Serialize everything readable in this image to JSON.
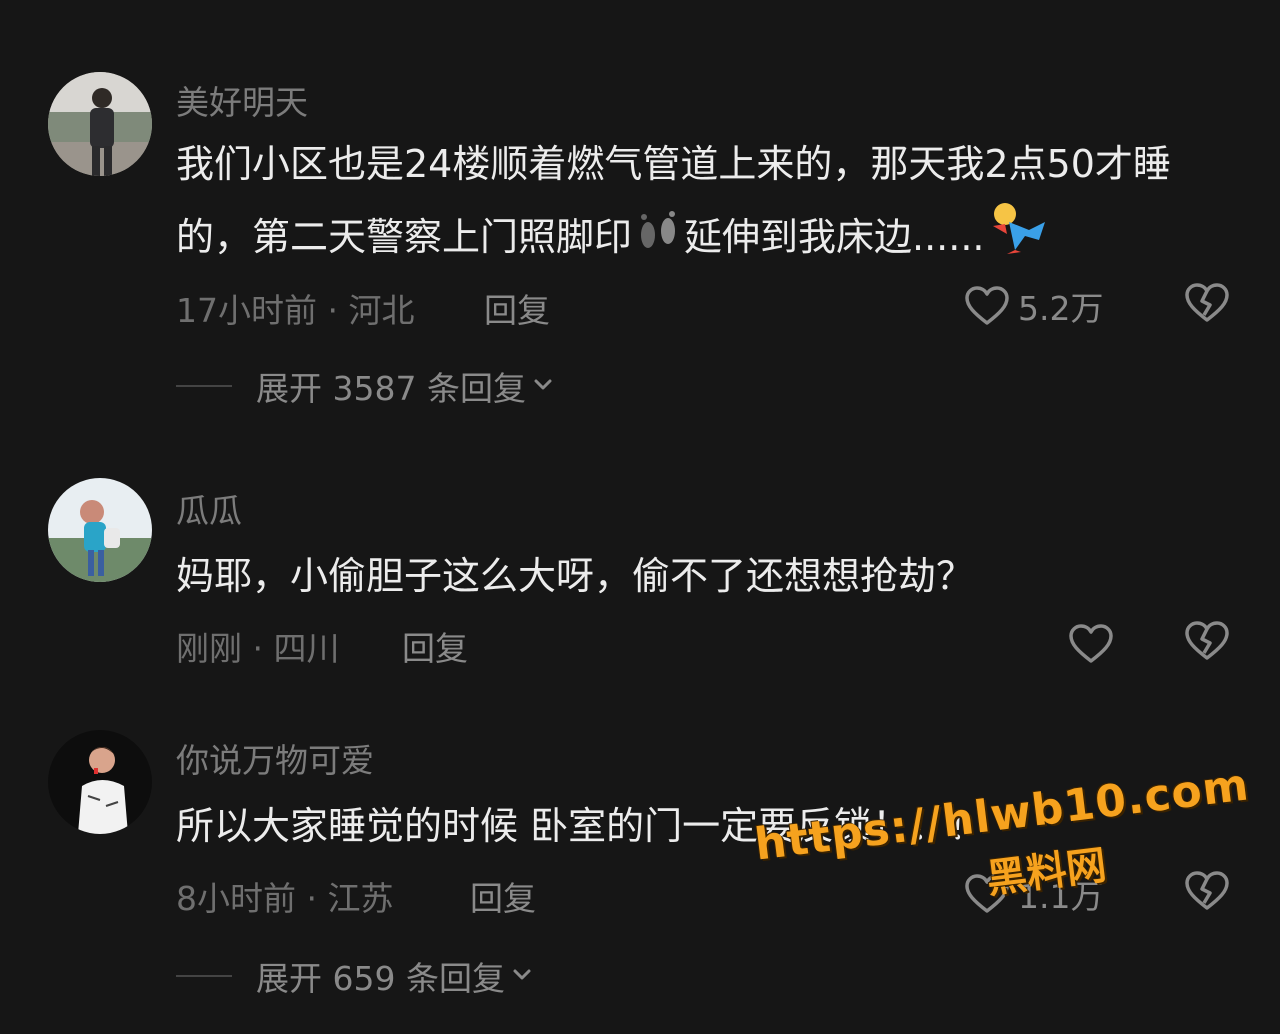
{
  "comments": [
    {
      "username": "美好明天",
      "text_a": "我们小区也是24楼顺着燃气管道上来的，那天我2点50才睡的，第二天警察上门照脚印",
      "text_b": "延伸到我床边......",
      "meta": "17小时前 · 河北",
      "reply_label": "回复",
      "likes": "5.2万",
      "expand_label": "展开 3587 条回复"
    },
    {
      "username": "瓜瓜",
      "text": "妈耶，小偷胆子这么大呀，偷不了还想想抢劫？",
      "meta": "刚刚 · 四川",
      "reply_label": "回复"
    },
    {
      "username": "你说万物可爱",
      "text": "所以大家睡觉的时候 卧室的门一定要反锁！！！",
      "meta": "8小时前 · 江苏",
      "reply_label": "回复",
      "likes": "1.1万",
      "expand_label": "展开 659 条回复"
    }
  ],
  "watermark": {
    "url": "https://hlwb10.com",
    "name": "黑料网"
  },
  "icons": {
    "like": "heart-outline-icon",
    "dislike": "broken-heart-icon",
    "expand": "chevron-down-icon",
    "footprints": "footprints-emoji",
    "falling": "falling-person-emoji"
  },
  "colors": {
    "background": "#161616",
    "text": "#ececec",
    "muted": "#7c7c7c",
    "watermark": "#f6a21e"
  }
}
